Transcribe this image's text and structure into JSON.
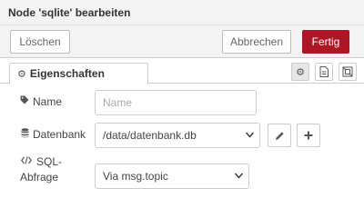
{
  "dialog": {
    "title": "Node 'sqlite' bearbeiten"
  },
  "toolbar": {
    "delete_label": "Löschen",
    "cancel_label": "Abbrechen",
    "done_label": "Fertig",
    "done_color": "#ad1625"
  },
  "tabs": {
    "properties_label": "Eigenschaften",
    "properties_icon": "gear-icon",
    "icon_buttons": [
      "gear-icon",
      "description-icon",
      "appearance-icon"
    ]
  },
  "form": {
    "name": {
      "label": "Name",
      "icon": "tag-icon",
      "placeholder": "Name",
      "value": ""
    },
    "database": {
      "label": "Datenbank",
      "icon": "database-icon",
      "value": "/data/datenbank.db",
      "edit_icon": "pencil-icon",
      "add_icon": "plus-icon"
    },
    "sql_query": {
      "label_line1": "SQL-",
      "label_line2": "Abfrage",
      "icon": "code-icon",
      "value": "Via msg.topic"
    }
  }
}
